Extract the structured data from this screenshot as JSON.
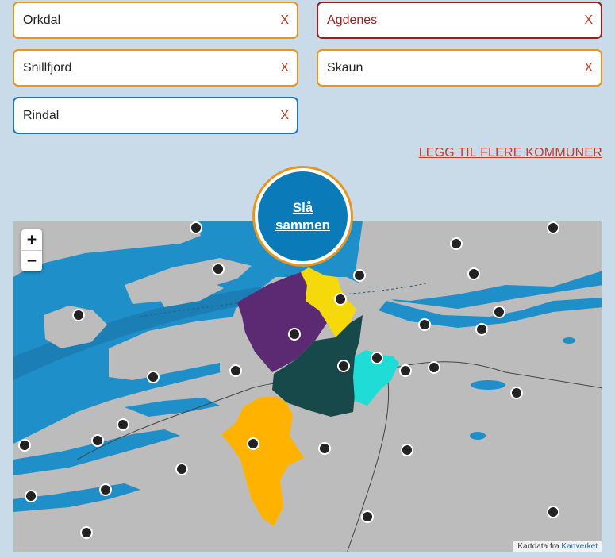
{
  "municipalities": [
    {
      "value": "Orkdal",
      "clear": "X"
    },
    {
      "value": "Agdenes",
      "clear": "X"
    },
    {
      "value": "Snillfjord",
      "clear": "X"
    },
    {
      "value": "Skaun",
      "clear": "X"
    },
    {
      "value": "Rindal",
      "clear": "X"
    }
  ],
  "add_more_label": "LEGG TIL FLERE KOMMUNER",
  "merge_button_label": "Slå sammen",
  "map": {
    "zoom_in": "+",
    "zoom_out": "−",
    "attribution_prefix": "Kartdata fra",
    "attribution_link": "Kartverket",
    "region_colors": {
      "purple": "#5c2a72",
      "yellow": "#f5d90a",
      "dark_green": "#17494a",
      "cyan": "#1fdcd6",
      "orange": "#ffb300"
    },
    "colors": {
      "water": "#1f8fc9",
      "land": "#bcbcbc"
    }
  },
  "colors": {
    "orange_border": "#e8951e",
    "red_border": "#9b1c1c",
    "blue_border": "#1a78b8",
    "link_red": "#c0402a"
  }
}
